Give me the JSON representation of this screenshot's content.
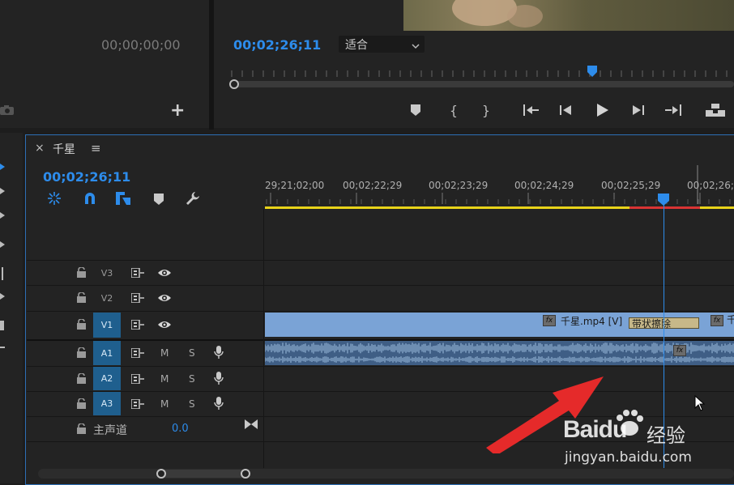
{
  "source_monitor": {
    "timecode": "00;00;00;00",
    "add_label": "+"
  },
  "program_monitor": {
    "timecode": "00;02;26;11",
    "fit_select": "适合",
    "transport": [
      "marker-icon",
      "mark-in-icon",
      "mark-out-icon",
      "go-to-in-icon",
      "step-back-icon",
      "play-icon",
      "step-forward-icon",
      "go-to-out-icon",
      "lift-icon"
    ]
  },
  "timeline": {
    "close_label": "×",
    "sequence_name": "千星",
    "menu_label": "≡",
    "timecode": "00;02;26;11",
    "ruler_labels": [
      "00;02;21;29",
      "00;02;22;29",
      "00;02;23;29",
      "00;02;24;29",
      "00;02;25;29",
      "00;02;26;"
    ],
    "tracks": {
      "video": [
        {
          "name": "V3",
          "targeted": false
        },
        {
          "name": "V2",
          "targeted": false
        },
        {
          "name": "V1",
          "targeted": true
        }
      ],
      "audio": [
        {
          "name": "A1",
          "mute": "M",
          "solo": "S"
        },
        {
          "name": "A2",
          "mute": "M",
          "solo": "S"
        },
        {
          "name": "A3",
          "mute": "M",
          "solo": "S"
        }
      ],
      "master": {
        "label": "主声道",
        "value": "0.0"
      }
    },
    "clip": {
      "fx": "fx",
      "name": "千星.mp4 [V]",
      "transition": "带状擦除",
      "fx2": "fx",
      "fx3": "fx",
      "tail": "千"
    }
  },
  "watermark": {
    "brand": "Baidu",
    "product": "经验",
    "url": "jingyan.baidu.com"
  },
  "colors": {
    "accent_blue": "#2d8ceb",
    "work_area_yellow": "#e8d31a",
    "render_red": "#d93434",
    "clip_blue": "#7aa3d6",
    "track_target": "#1f5f8e",
    "arrow_red": "#e52a2a"
  }
}
